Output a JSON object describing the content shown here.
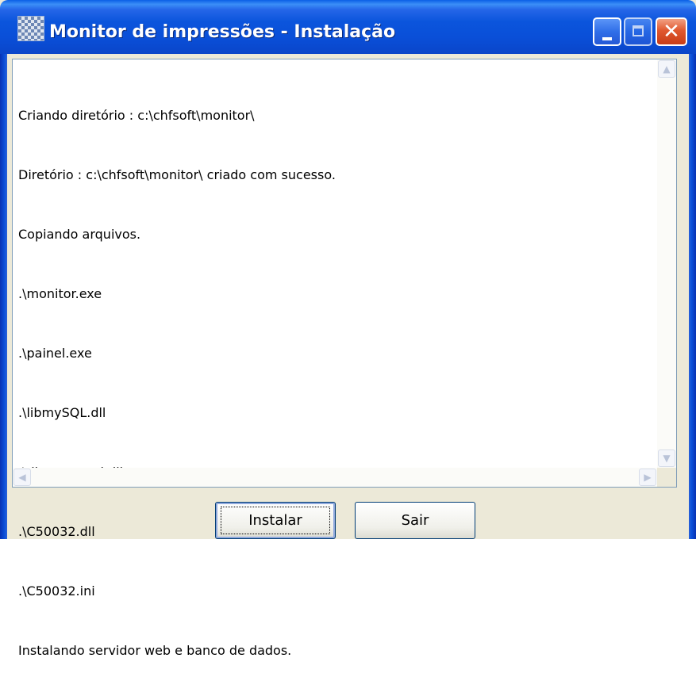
{
  "window": {
    "title": "Monitor de impressões - Instalação"
  },
  "log": {
    "lines": [
      "Criando diretório : c:\\chfsoft\\monitor\\",
      "Diretório : c:\\chfsoft\\monitor\\ criado com sucesso.",
      "Copiando arquivos.",
      ".\\monitor.exe",
      ".\\painel.exe",
      ".\\libmySQL.dll",
      ".\\dbexpmysql.dll",
      ".\\C50032.dll",
      ".\\C50032.ini",
      "Instalando servidor web e banco de dados."
    ]
  },
  "buttons": {
    "install_label": "Instalar",
    "exit_label": "Sair"
  },
  "icons": {
    "app": "app-icon",
    "minimize": "minimize-icon",
    "maximize": "maximize-icon",
    "close": "close-icon"
  },
  "colors": {
    "titlebar": "#0a4fd8",
    "close_button": "#e0582f",
    "window_bg": "#ece9d8"
  }
}
